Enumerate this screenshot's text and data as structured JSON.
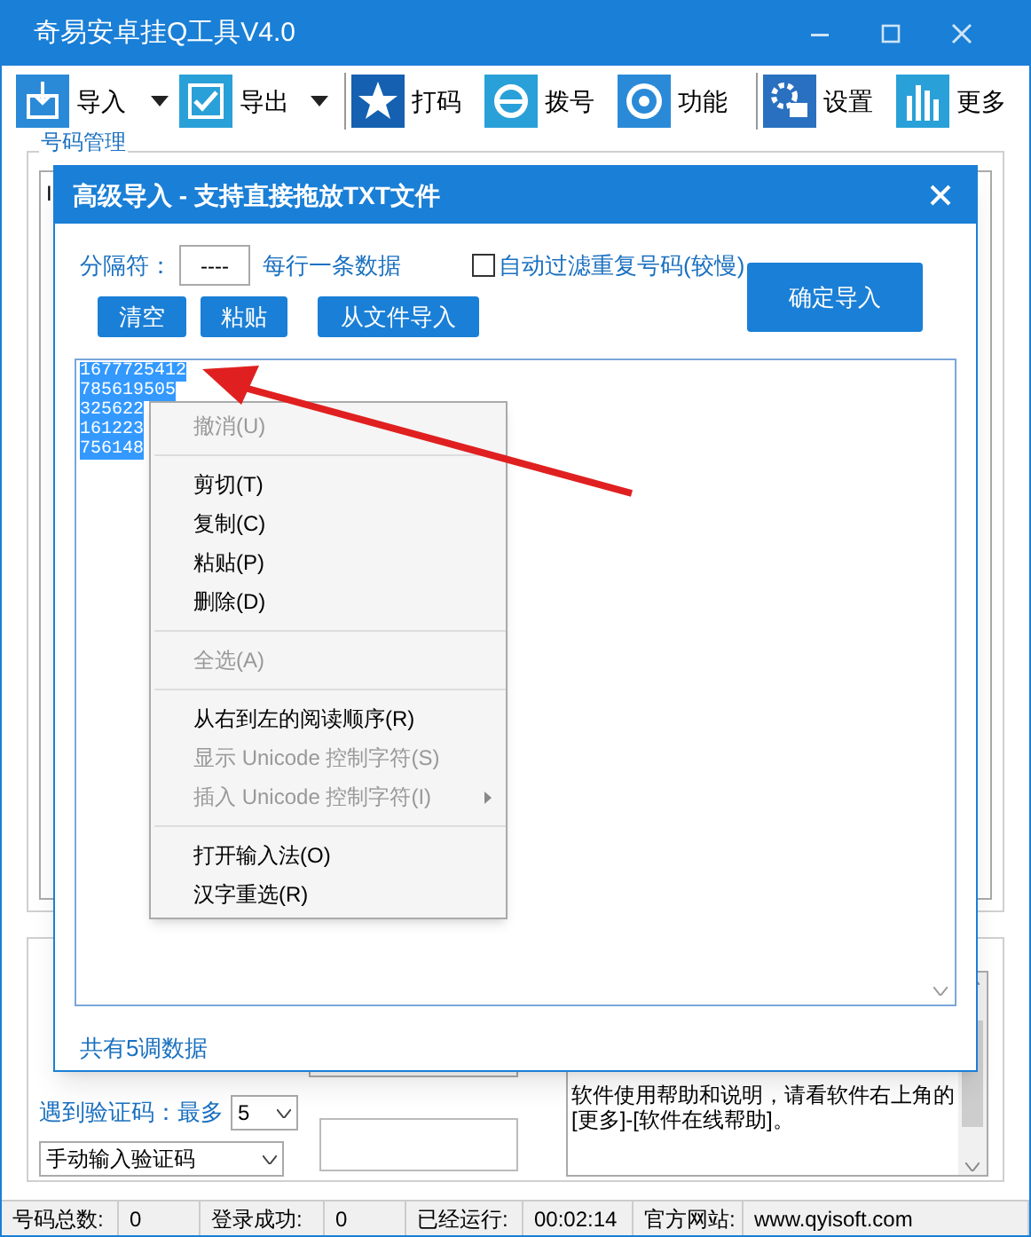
{
  "window": {
    "title": "奇易安卓挂Q工具V4.0"
  },
  "toolbar": [
    {
      "label": "导入",
      "kind": "dropdown"
    },
    {
      "label": "导出",
      "kind": "dropdown"
    },
    {
      "label": "打码",
      "kind": "button"
    },
    {
      "label": "拨号",
      "kind": "button"
    },
    {
      "label": "功能",
      "kind": "button"
    },
    {
      "label": "设置",
      "kind": "button"
    },
    {
      "label": "更多",
      "kind": "button"
    }
  ],
  "number_group": {
    "title": "号码管理",
    "column_1": "I"
  },
  "captcha": {
    "label": "遇到验证码：最多",
    "max": "5",
    "mode": "手动输入验证码"
  },
  "help_box": {
    "text": "软件使用帮助和说明，请看软件右上角的[更多]-[软件在线帮助]。"
  },
  "status_bar": [
    {
      "label": "号码总数:",
      "value": "0"
    },
    {
      "label": "登录成功:",
      "value": "0"
    },
    {
      "label": "已经运行:",
      "value": "00:02:14"
    },
    {
      "label": "官方网站:",
      "value": "www.qyisoft.com"
    }
  ],
  "dialog": {
    "title": "高级导入 - 支持直接拖放TXT文件",
    "separator_label": "分隔符：",
    "separator_value": "----",
    "hint": "每行一条数据",
    "filter": {
      "label": "自动过滤重复号码(较慢)",
      "checked": false
    },
    "buttons": [
      "清空",
      "粘贴",
      "从文件导入"
    ],
    "confirm": "确定导入",
    "lines": [
      {
        "text": "1677725412",
        "selected": true
      },
      {
        "text": "785619505",
        "selected": true
      },
      {
        "text": "325622",
        "selected": true
      },
      {
        "text": "161223",
        "selected": true
      },
      {
        "text": "756148",
        "selected": true
      }
    ],
    "count": "共有5调数据"
  },
  "context_menu": [
    {
      "kind": "item",
      "label": "撤消(U)",
      "disabled": true
    },
    {
      "kind": "separator"
    },
    {
      "kind": "item",
      "label": "剪切(T)",
      "disabled": false
    },
    {
      "kind": "item",
      "label": "复制(C)",
      "disabled": false
    },
    {
      "kind": "item",
      "label": "粘贴(P)",
      "disabled": false
    },
    {
      "kind": "item",
      "label": "删除(D)",
      "disabled": false
    },
    {
      "kind": "separator"
    },
    {
      "kind": "item",
      "label": "全选(A)",
      "disabled": true
    },
    {
      "kind": "separator"
    },
    {
      "kind": "item",
      "label": "从右到左的阅读顺序(R)",
      "disabled": false
    },
    {
      "kind": "item",
      "label": "显示 Unicode 控制字符(S)",
      "disabled": true
    },
    {
      "kind": "submenu",
      "label": "插入 Unicode 控制字符(I)",
      "disabled": true
    },
    {
      "kind": "separator"
    },
    {
      "kind": "item",
      "label": "打开输入法(O)",
      "disabled": false
    },
    {
      "kind": "item",
      "label": "汉字重选(R)",
      "disabled": false
    }
  ]
}
